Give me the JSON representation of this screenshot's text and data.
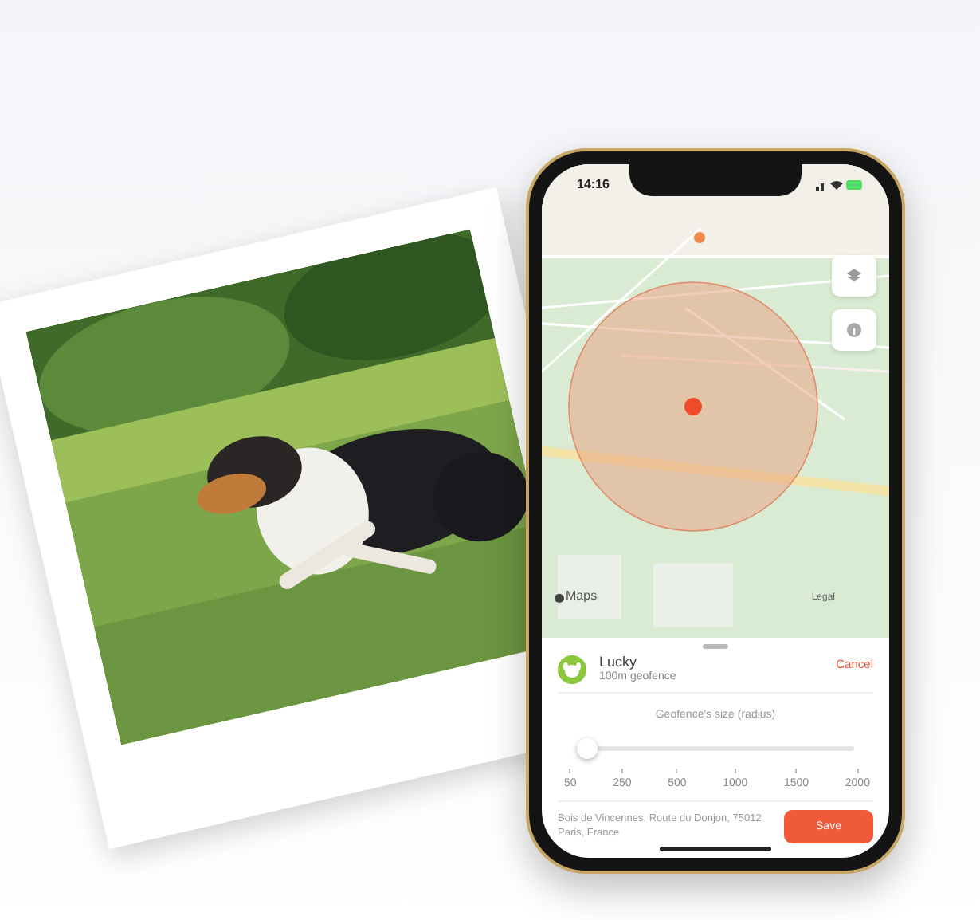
{
  "status_bar": {
    "time": "14:16"
  },
  "map": {
    "attribution": "Maps",
    "legal": "Legal"
  },
  "geofence": {
    "pet_name": "Lucky",
    "subtitle": "100m geofence",
    "cancel": "Cancel",
    "slider_label": "Geofence's size (radius)",
    "level": 0,
    "ticks": [
      "50",
      "250",
      "500",
      "1000",
      "1500",
      "2000"
    ],
    "address": "Bois de Vincennes, Route du Donjon, 75012 Paris, France",
    "save": "Save"
  }
}
